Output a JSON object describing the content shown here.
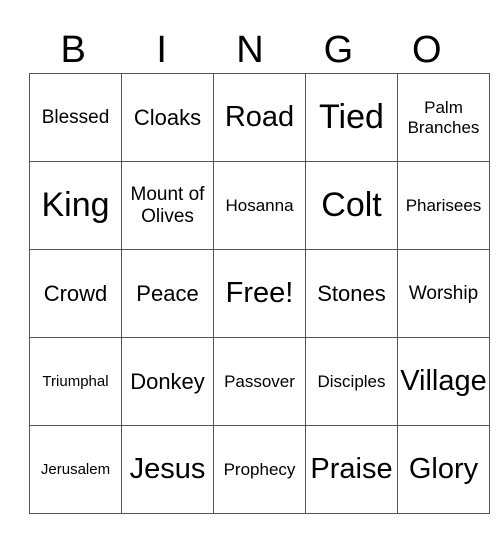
{
  "header": [
    "B",
    "I",
    "N",
    "G",
    "O"
  ],
  "rows": [
    [
      "Blessed",
      "Cloaks",
      "Road",
      "Tied",
      "Palm Branches"
    ],
    [
      "King",
      "Mount of Olives",
      "Hosanna",
      "Colt",
      "Pharisees"
    ],
    [
      "Crowd",
      "Peace",
      "Free!",
      "Stones",
      "Worship"
    ],
    [
      "Triumphal",
      "Donkey",
      "Passover",
      "Disciples",
      "Village"
    ],
    [
      "Jerusalem",
      "Jesus",
      "Prophecy",
      "Praise",
      "Glory"
    ]
  ]
}
